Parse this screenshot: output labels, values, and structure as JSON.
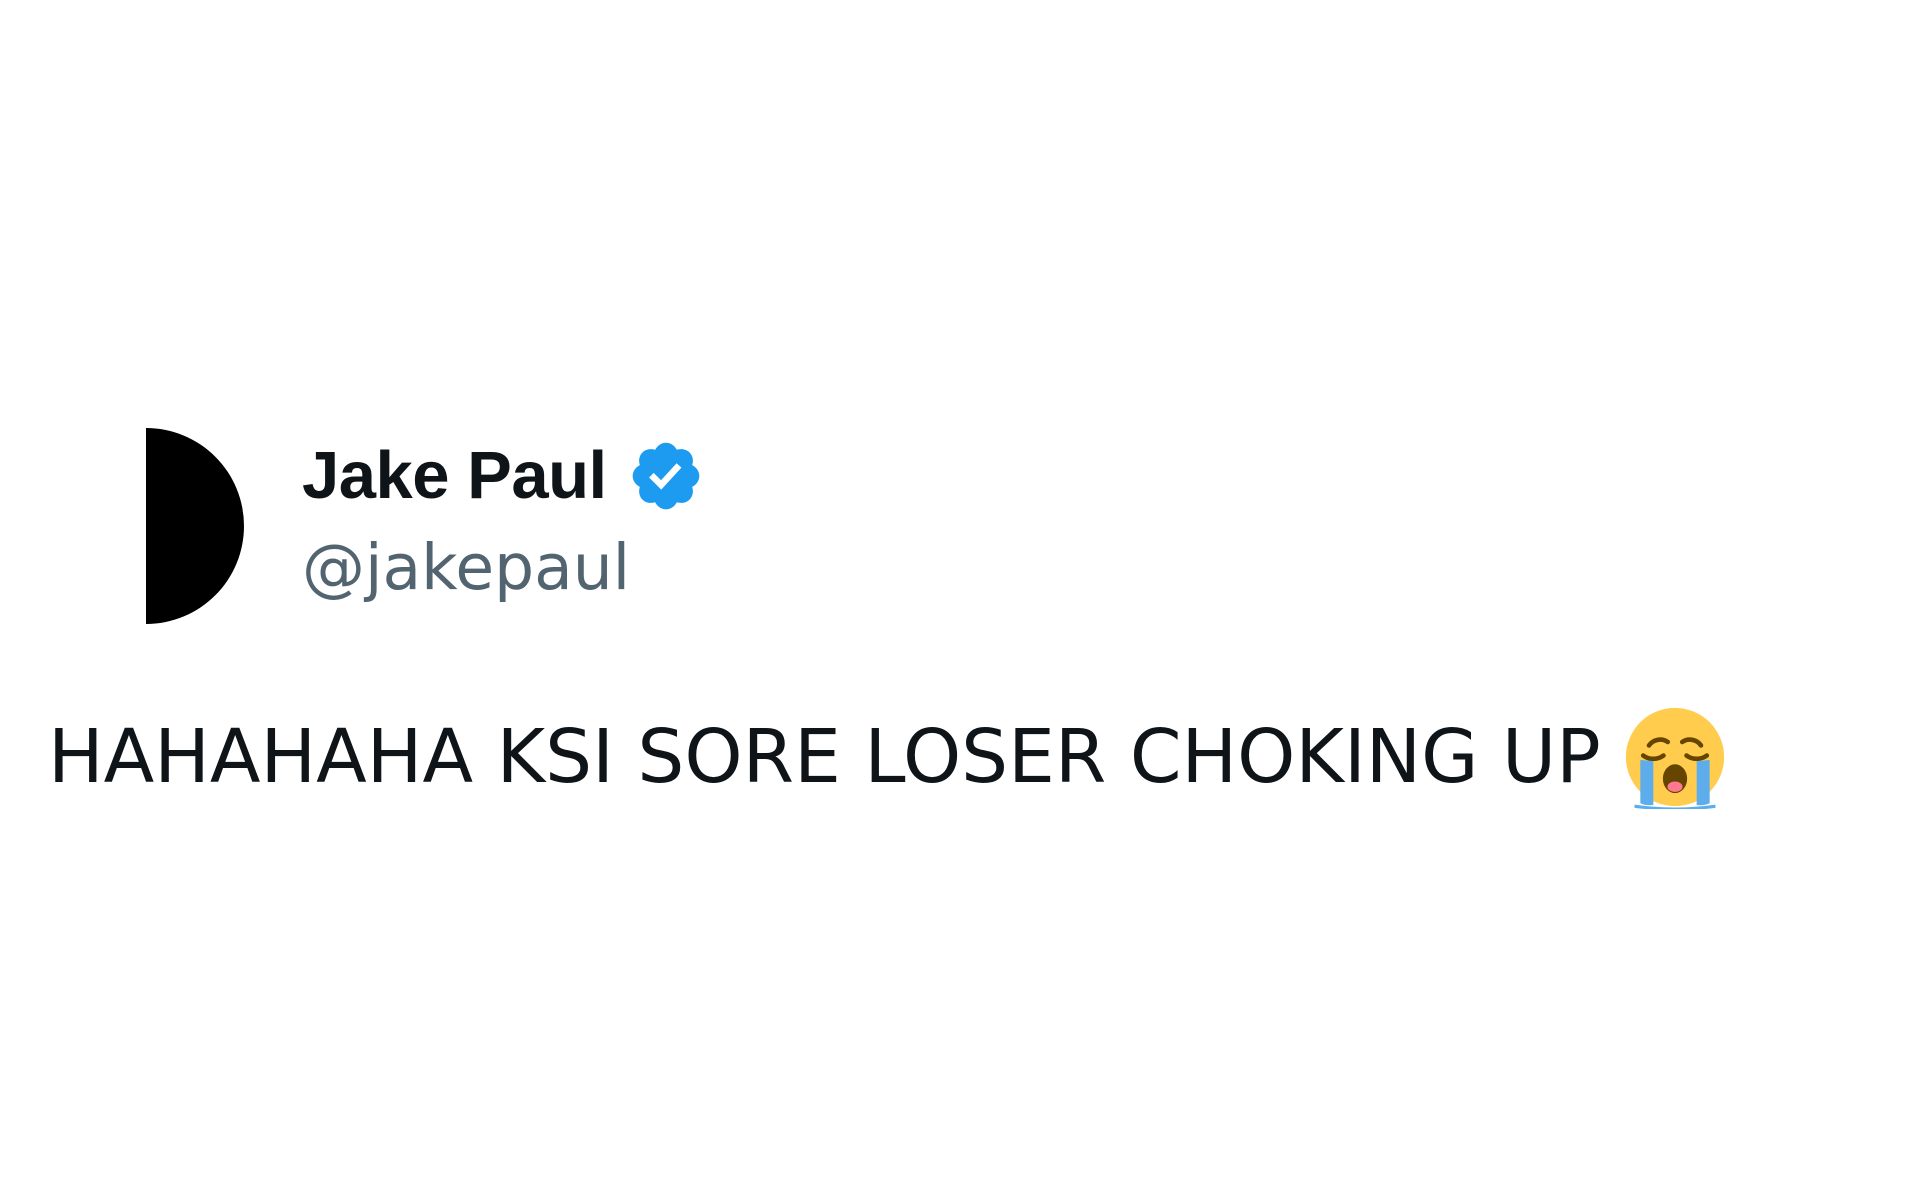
{
  "tweet": {
    "author": {
      "display_name": "Jake Paul",
      "handle": "@jakepaul",
      "verified": true,
      "verified_badge_icon": "verified-badge-icon",
      "verified_color": "#1d9bf0",
      "avatar_icon": "half-moon-avatar"
    },
    "text": "HAHAHAHA KSI SORE LOSER CHOKING UP",
    "emoji": {
      "name": "loudly-crying-face-icon",
      "face_color": "#ffcc4d",
      "tear_color": "#5dadec"
    }
  },
  "colors": {
    "background": "#ffffff",
    "text_primary": "#0f1419",
    "text_secondary": "#536471"
  }
}
